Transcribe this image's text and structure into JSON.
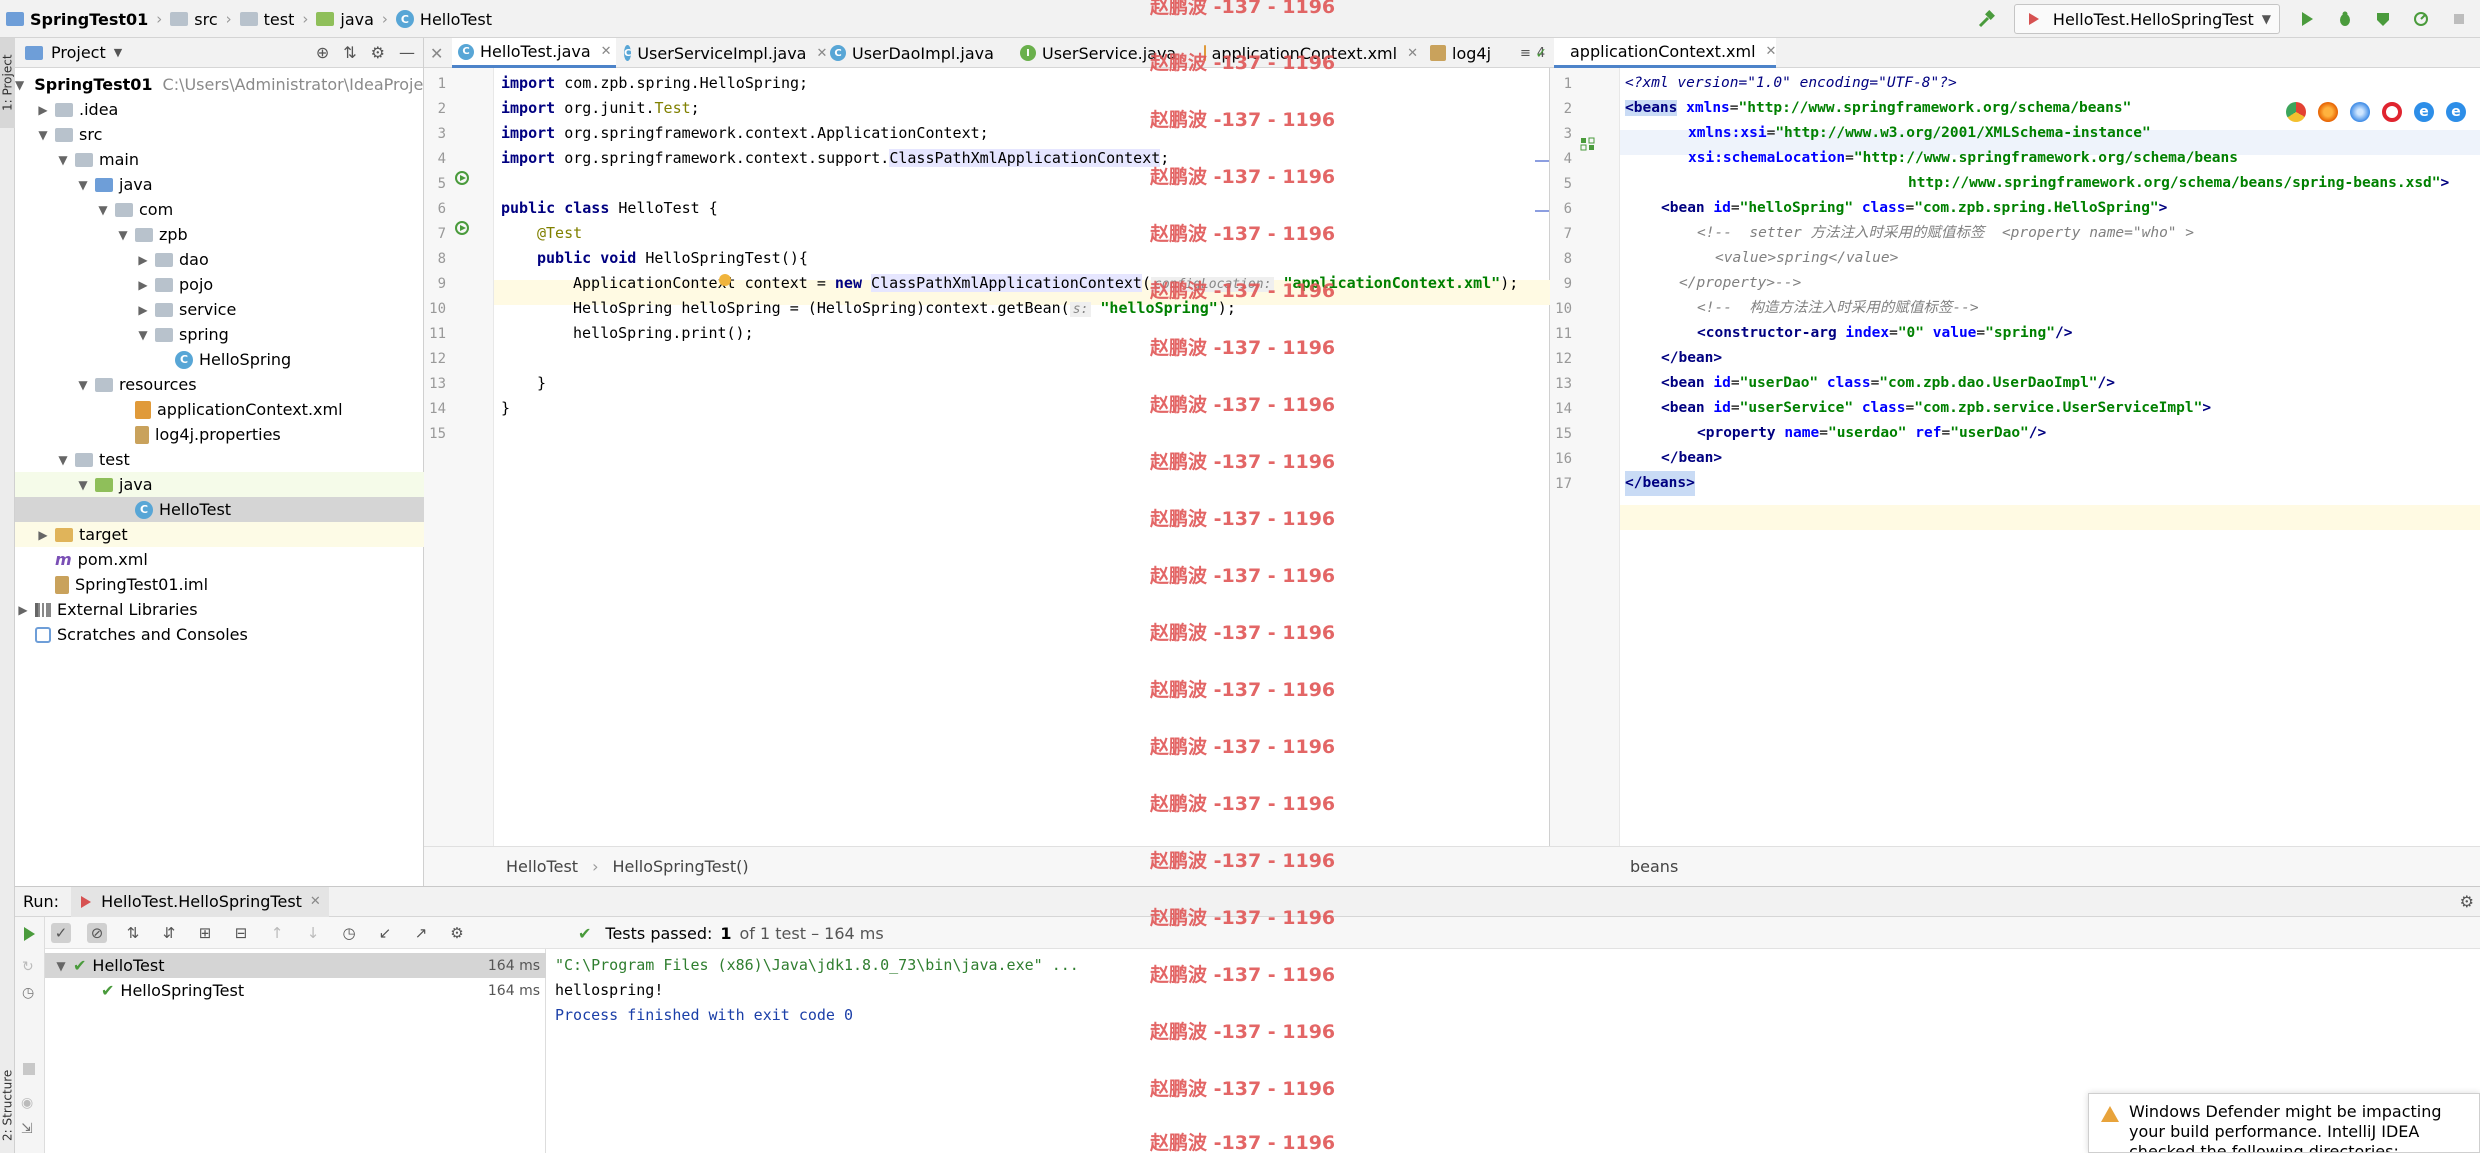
{
  "breadcrumbs": [
    "SpringTest01",
    "src",
    "test",
    "java",
    "HelloTest"
  ],
  "run_config": "HelloTest.HelloSpringTest",
  "left_stripe": {
    "project": "1: Project",
    "structure": "2: Structure"
  },
  "project_panel": {
    "title": "Project",
    "tree": [
      {
        "label": "SpringTest01",
        "extra": "C:\\Users\\Administrator\\IdeaProject"
      },
      {
        "label": ".idea"
      },
      {
        "label": "src"
      },
      {
        "label": "main"
      },
      {
        "label": "java"
      },
      {
        "label": "com"
      },
      {
        "label": "zpb"
      },
      {
        "label": "dao"
      },
      {
        "label": "pojo"
      },
      {
        "label": "service"
      },
      {
        "label": "spring"
      },
      {
        "label": "HelloSpring"
      },
      {
        "label": "resources"
      },
      {
        "label": "applicationContext.xml"
      },
      {
        "label": "log4j.properties"
      },
      {
        "label": "test"
      },
      {
        "label": "java"
      },
      {
        "label": "HelloTest"
      },
      {
        "label": "target"
      },
      {
        "label": "pom.xml"
      },
      {
        "label": "SpringTest01.iml"
      },
      {
        "label": "External Libraries"
      },
      {
        "label": "Scratches and Consoles"
      }
    ]
  },
  "editor1": {
    "tabs": [
      "HelloTest.java",
      "UserServiceImpl.java",
      "UserDaoImpl.java",
      "UserService.java",
      "applicationContext.xml",
      "log4j"
    ],
    "overflow_count": "4",
    "line_numbers": [
      "1",
      "2",
      "3",
      "4",
      "5",
      "6",
      "7",
      "8",
      "9",
      "10",
      "11",
      "12",
      "13",
      "14",
      "15"
    ],
    "code": {
      "l1_kw": "import",
      "l1": " com.zpb.spring.HelloSpring;",
      "l2_kw": "import",
      "l2a": " org.junit.",
      "l2b": "Test",
      "l2c": ";",
      "l3_kw": "import",
      "l3": " org.springframework.context.ApplicationContext;",
      "l4_kw": "import",
      "l4a": " org.springframework.context.support.",
      "l4b": "ClassPathXmlApplicationContext",
      "l4c": ";",
      "l6_kw": "public class",
      "l6": " HelloTest {",
      "l7": "@Test",
      "l8_kw": "public void",
      "l8": " HelloSpringTest(){",
      "l9a": "ApplicationContext context = ",
      "l9_kw": "new",
      "l9b": " ",
      "l9c": "ClassPathXmlApplicationContext",
      "l9d": "(",
      "l9_hint": "configLocation:",
      "l9e": " ",
      "l9_str": "\"applicationContext.xml\"",
      "l9f": ");",
      "l10a": "HelloSpring helloSpring = (HelloSpring)context.getBean(",
      "l10_hint": "s:",
      "l10b": " ",
      "l10_str": "\"helloSpring\"",
      "l10c": ");",
      "l11": "helloSpring.print();",
      "l13": "}",
      "l14": "}"
    },
    "breadcrumb": [
      "HelloTest",
      "HelloSpringTest()"
    ]
  },
  "editor2": {
    "tab": "applicationContext.xml",
    "line_numbers": [
      "1",
      "2",
      "3",
      "4",
      "5",
      "6",
      "7",
      "8",
      "9",
      "10",
      "11",
      "12",
      "13",
      "14",
      "15",
      "16",
      "17"
    ],
    "xml": {
      "l1": "<?xml version=\"1.0\" encoding=\"UTF-8\"?>",
      "l2_tag": "<beans",
      "l2_attr": "xmlns",
      "l2_val": "\"http://www.springframework.org/schema/beans\"",
      "l3_attr": "xmlns:xsi",
      "l3_val": "\"http://www.w3.org/2001/XMLSchema-instance\"",
      "l4_attr": "xsi:schemaLocation",
      "l4_val": "\"http://www.springframework.org/schema/beans",
      "l5_val": "http://www.springframework.org/schema/beans/spring-beans.xsd\"",
      "l5_end": ">",
      "l6_tag": "<bean",
      "l6_a1": "id",
      "l6_v1": "\"helloSpring\"",
      "l6_a2": "class",
      "l6_v2": "\"com.zpb.spring.HelloSpring\"",
      "l6_end": ">",
      "l7": "<!--  setter 方法注入时采用的赋值标签  <property name=\"who\" >",
      "l8": "<value>spring</value>",
      "l9": "</property>-->",
      "l10": "<!--  构造方法注入时采用的赋值标签-->",
      "l11_tag": "<constructor-arg",
      "l11_a1": "index",
      "l11_v1": "\"0\"",
      "l11_a2": "value",
      "l11_v2": "\"spring\"",
      "l11_end": "/>",
      "l12": "</bean>",
      "l13_tag": "<bean",
      "l13_a1": "id",
      "l13_v1": "\"userDao\"",
      "l13_a2": "class",
      "l13_v2": "\"com.zpb.dao.UserDaoImpl\"",
      "l13_end": "/>",
      "l14_tag": "<bean",
      "l14_a1": "id",
      "l14_v1": "\"userService\"",
      "l14_a2": "class",
      "l14_v2": "\"com.zpb.service.UserServiceImpl\"",
      "l14_end": ">",
      "l15_tag": "<property",
      "l15_a1": "name",
      "l15_v1": "\"userdao\"",
      "l15_a2": "ref",
      "l15_v2": "\"userDao\"",
      "l15_end": "/>",
      "l16": "</bean>",
      "l17": "</beans>"
    },
    "breadcrumb": "beans"
  },
  "run_panel": {
    "label": "Run:",
    "tab": "HelloTest.HelloSpringTest",
    "status_prefix": "Tests passed:",
    "status_count": "1",
    "status_suffix": "of 1 test – 164 ms",
    "tests": [
      {
        "name": "HelloTest",
        "time": "164 ms"
      },
      {
        "name": "HelloSpringTest",
        "time": "164 ms"
      }
    ],
    "console": [
      "\"C:\\Program Files (x86)\\Java\\jdk1.8.0_73\\bin\\java.exe\" ...",
      "hellospring!",
      "Process finished with exit code 0"
    ]
  },
  "notification": "Windows Defender might be impacting your build performance. IntelliJ IDEA checked the following directories:",
  "watermark": "赵鹏波 -137 - 1196",
  "colors": {
    "keyword": "#000080",
    "string": "#008000",
    "annotation": "#808000",
    "watermark": "#e05656",
    "success": "#4a9b3c"
  }
}
